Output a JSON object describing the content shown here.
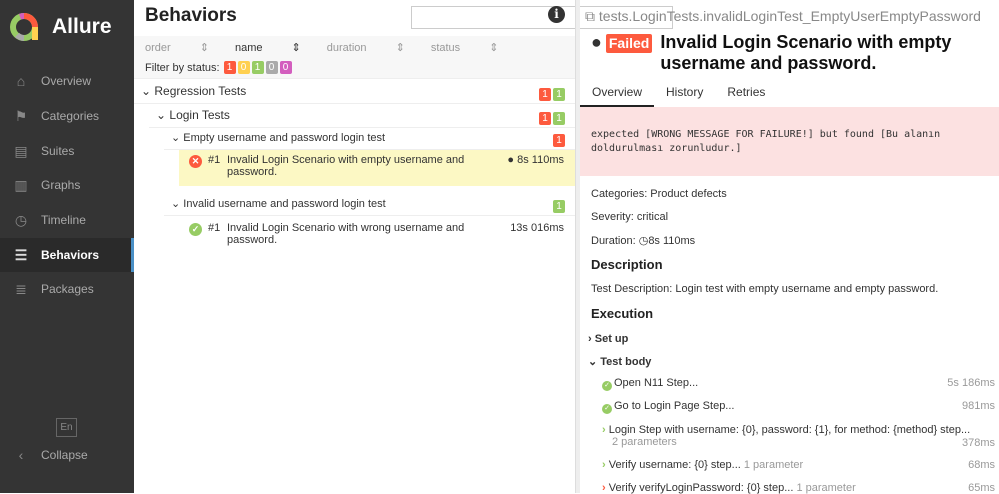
{
  "app": {
    "name": "Allure"
  },
  "sidebar": {
    "items": [
      {
        "label": "Overview",
        "icon": "home-icon"
      },
      {
        "label": "Categories",
        "icon": "flag-icon"
      },
      {
        "label": "Suites",
        "icon": "briefcase-icon"
      },
      {
        "label": "Graphs",
        "icon": "bar-chart-icon"
      },
      {
        "label": "Timeline",
        "icon": "clock-icon"
      },
      {
        "label": "Behaviors",
        "icon": "list-icon"
      },
      {
        "label": "Packages",
        "icon": "stack-icon"
      }
    ],
    "language": "En",
    "collapse": "Collapse"
  },
  "behaviors": {
    "title": "Behaviors",
    "search_value": "",
    "sort": {
      "order": "order",
      "name": "name",
      "duration": "duration",
      "status": "status"
    },
    "filter_label": "Filter by status:",
    "filter_counts": {
      "failed": "1",
      "broken": "0",
      "passed": "1",
      "skipped": "0",
      "unknown": "0"
    },
    "tree": {
      "regression": {
        "label": "Regression Tests",
        "failed": "1",
        "passed": "1"
      },
      "login": {
        "label": "Login Tests",
        "failed": "1",
        "passed": "1"
      },
      "empty": {
        "label": "Empty username and password login test",
        "failed": "1",
        "test": {
          "num": "#1",
          "title": "Invalid Login Scenario with empty username and password.",
          "duration": "8s 110ms"
        }
      },
      "invalid": {
        "label": "Invalid username and password login test",
        "passed": "1",
        "test": {
          "num": "#1",
          "title": "Invalid Login Scenario with wrong username and password.",
          "duration": "13s 016ms"
        }
      }
    }
  },
  "detail": {
    "uid": "tests.LoginTests.invalidLoginTest_EmptyUserEmptyPassword",
    "status": "Failed",
    "title": "Invalid Login Scenario with empty username and password.",
    "tabs": [
      "Overview",
      "History",
      "Retries"
    ],
    "error": "expected [WRONG MESSAGE FOR FAILURE!] but found [Bu alanın doldurulması zorunludur.]",
    "categories": "Categories: Product defects",
    "severity": "Severity: critical",
    "duration_label": "Duration:",
    "duration": "8s 110ms",
    "description_heading": "Description",
    "description": "Test Description: Login test with empty username and empty password.",
    "execution_heading": "Execution",
    "setup": "Set up",
    "body": "Test body",
    "steps": [
      {
        "name": "Open N11 Step...",
        "params": "",
        "duration": "5s 186ms"
      },
      {
        "name": "Go to Login Page Step...",
        "params": "",
        "duration": "981ms"
      },
      {
        "name": "Login Step with username: {0}, password: {1}, for method: {method} step...",
        "params": "2 parameters",
        "duration": "378ms"
      },
      {
        "name": "Verify username: {0} step...",
        "params": "1 parameter",
        "duration": "68ms"
      },
      {
        "name": "Verify verifyLoginPassword: {0} step...",
        "params": "1 parameter",
        "duration": "65ms"
      }
    ]
  },
  "colors": {
    "failed": "#fd5a3e",
    "passed": "#97cc64",
    "broken": "#ffd050",
    "skipped": "#aaaaaa",
    "unknown": "#d35ebe"
  }
}
